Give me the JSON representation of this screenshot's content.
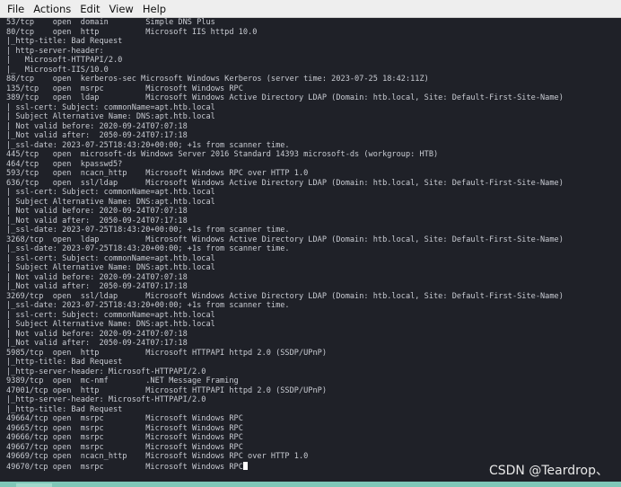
{
  "menu": [
    "File",
    "Actions",
    "Edit",
    "View",
    "Help"
  ],
  "terminal_lines": [
    "53/tcp    open  domain        Simple DNS Plus",
    "80/tcp    open  http          Microsoft IIS httpd 10.0",
    "|_http-title: Bad Request",
    "| http-server-header:",
    "|   Microsoft-HTTPAPI/2.0",
    "|_  Microsoft-IIS/10.0",
    "88/tcp    open  kerberos-sec Microsoft Windows Kerberos (server time: 2023-07-25 18:42:11Z)",
    "135/tcp   open  msrpc         Microsoft Windows RPC",
    "389/tcp   open  ldap          Microsoft Windows Active Directory LDAP (Domain: htb.local, Site: Default-First-Site-Name)",
    "| ssl-cert: Subject: commonName=apt.htb.local",
    "| Subject Alternative Name: DNS:apt.htb.local",
    "| Not valid before: 2020-09-24T07:07:18",
    "|_Not valid after:  2050-09-24T07:17:18",
    "|_ssl-date: 2023-07-25T18:43:20+00:00; +1s from scanner time.",
    "445/tcp   open  microsoft-ds Windows Server 2016 Standard 14393 microsoft-ds (workgroup: HTB)",
    "464/tcp   open  kpasswd5?",
    "593/tcp   open  ncacn_http    Microsoft Windows RPC over HTTP 1.0",
    "636/tcp   open  ssl/ldap      Microsoft Windows Active Directory LDAP (Domain: htb.local, Site: Default-First-Site-Name)",
    "| ssl-cert: Subject: commonName=apt.htb.local",
    "| Subject Alternative Name: DNS:apt.htb.local",
    "| Not valid before: 2020-09-24T07:07:18",
    "|_Not valid after:  2050-09-24T07:17:18",
    "|_ssl-date: 2023-07-25T18:43:20+00:00; +1s from scanner time.",
    "3268/tcp  open  ldap          Microsoft Windows Active Directory LDAP (Domain: htb.local, Site: Default-First-Site-Name)",
    "|_ssl-date: 2023-07-25T18:43:20+00:00; +1s from scanner time.",
    "| ssl-cert: Subject: commonName=apt.htb.local",
    "| Subject Alternative Name: DNS:apt.htb.local",
    "| Not valid before: 2020-09-24T07:07:18",
    "|_Not valid after:  2050-09-24T07:17:18",
    "3269/tcp  open  ssl/ldap      Microsoft Windows Active Directory LDAP (Domain: htb.local, Site: Default-First-Site-Name)",
    "|_ssl-date: 2023-07-25T18:43:20+00:00; +1s from scanner time.",
    "| ssl-cert: Subject: commonName=apt.htb.local",
    "| Subject Alternative Name: DNS:apt.htb.local",
    "| Not valid before: 2020-09-24T07:07:18",
    "|_Not valid after:  2050-09-24T07:17:18",
    "5985/tcp  open  http          Microsoft HTTPAPI httpd 2.0 (SSDP/UPnP)",
    "|_http-title: Bad Request",
    "|_http-server-header: Microsoft-HTTPAPI/2.0",
    "9389/tcp  open  mc-nmf        .NET Message Framing",
    "47001/tcp open  http          Microsoft HTTPAPI httpd 2.0 (SSDP/UPnP)",
    "|_http-server-header: Microsoft-HTTPAPI/2.0",
    "|_http-title: Bad Request",
    "49664/tcp open  msrpc         Microsoft Windows RPC",
    "49665/tcp open  msrpc         Microsoft Windows RPC",
    "49666/tcp open  msrpc         Microsoft Windows RPC",
    "49667/tcp open  msrpc         Microsoft Windows RPC",
    "49669/tcp open  ncacn_http    Microsoft Windows RPC over HTTP 1.0",
    "49670/tcp open  msrpc         Microsoft Windows RPC"
  ],
  "watermark": "CSDN @Teardrop、"
}
